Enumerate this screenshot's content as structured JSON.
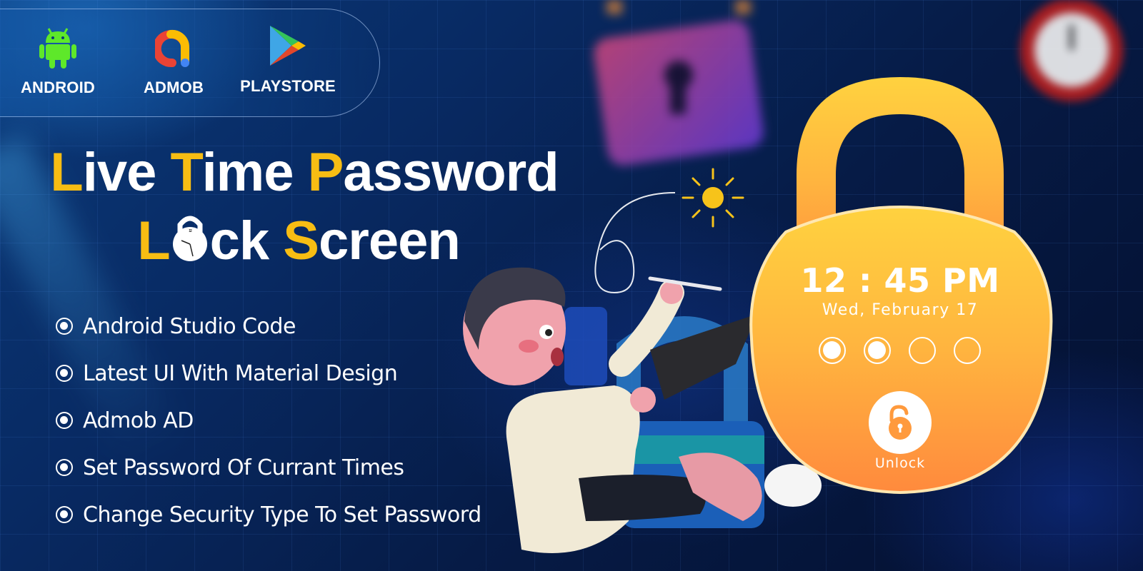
{
  "platforms": [
    {
      "label": "ANDROID",
      "icon": "android-icon",
      "color": "#5ee82a"
    },
    {
      "label": "ADMOB",
      "icon": "admob-icon"
    },
    {
      "label": "PLAYSTORE",
      "icon": "playstore-icon"
    }
  ],
  "title": {
    "line1": [
      {
        "accent": "L",
        "rest": "ive "
      },
      {
        "accent": "T",
        "rest": "ime "
      },
      {
        "accent": "P",
        "rest": "assword"
      }
    ],
    "line2": {
      "accent1": "L",
      "o_icon": "clock-lock-icon",
      "rest1": "ck ",
      "accent2": "S",
      "rest2": "creen"
    },
    "accent_color": "#f7bd13"
  },
  "features": [
    "Android Studio Code",
    "Latest UI With Material Design",
    "Admob AD",
    "Set Password Of Currant Times",
    "Change Security Type To Set Password"
  ],
  "lock_screen": {
    "time": "12 : 45 PM",
    "date": "Wed, February 17",
    "pin_length": 4,
    "pin_filled": 2,
    "unlock_label": "Unlock",
    "gradient_top": "#ffd23f",
    "gradient_bottom": "#ff8a3d"
  }
}
